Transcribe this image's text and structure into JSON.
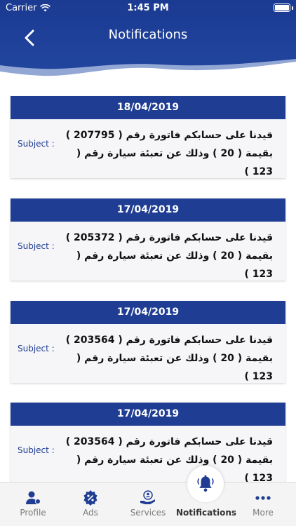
{
  "status_bar": {
    "carrier": "Carrier",
    "time": "1:45 PM"
  },
  "header": {
    "title": "Notifications",
    "back_icon": "chevron-left-icon"
  },
  "colors": {
    "primary": "#1f3e93",
    "header_dark": "#1e3b8f",
    "card_bg": "#f6f6f8",
    "tab_bg": "#f4f4f4"
  },
  "notifications": [
    {
      "date": "18/04/2019",
      "subject_label": "Subject :",
      "message": "قيدنا على حسابكم فاتورة رقم ( 207795 ) بقيمة ( 20 ) وذلك عن تعبئة سيارة رقم ( 123 )"
    },
    {
      "date": "17/04/2019",
      "subject_label": "Subject :",
      "message": "قيدنا على حسابكم فاتورة رقم ( 205372 ) بقيمة ( 20 ) وذلك عن تعبئة سيارة رقم ( 123 )"
    },
    {
      "date": "17/04/2019",
      "subject_label": "Subject :",
      "message": "قيدنا على حسابكم فاتورة رقم ( 203564 ) بقيمة ( 20 ) وذلك عن تعبئة سيارة رقم ( 123 )"
    },
    {
      "date": "17/04/2019",
      "subject_label": "Subject :",
      "message": "قيدنا على حسابكم فاتورة رقم ( 203564 ) بقيمة ( 20 ) وذلك عن تعبئة سيارة رقم ( 123 )"
    }
  ],
  "tabs": [
    {
      "label": "Profile",
      "icon": "profile-icon",
      "active": false
    },
    {
      "label": "Ads",
      "icon": "percent-badge-icon",
      "active": false
    },
    {
      "label": "Services",
      "icon": "services-icon",
      "active": false
    },
    {
      "label": "Notifications",
      "icon": "bell-icon",
      "active": true
    },
    {
      "label": "More",
      "icon": "more-dots-icon",
      "active": false
    }
  ]
}
